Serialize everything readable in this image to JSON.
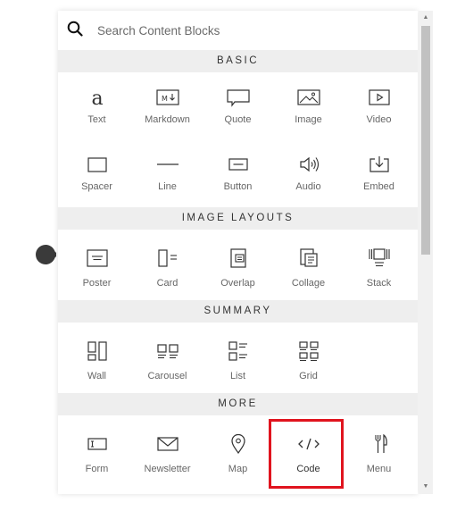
{
  "search": {
    "placeholder": "Search Content Blocks"
  },
  "sections": {
    "basic": {
      "title": "BASIC",
      "items": [
        {
          "label": "Text",
          "icon": "text-icon"
        },
        {
          "label": "Markdown",
          "icon": "markdown-icon"
        },
        {
          "label": "Quote",
          "icon": "quote-icon"
        },
        {
          "label": "Image",
          "icon": "image-icon"
        },
        {
          "label": "Video",
          "icon": "video-icon"
        },
        {
          "label": "Spacer",
          "icon": "spacer-icon"
        },
        {
          "label": "Line",
          "icon": "line-icon"
        },
        {
          "label": "Button",
          "icon": "button-icon"
        },
        {
          "label": "Audio",
          "icon": "audio-icon"
        },
        {
          "label": "Embed",
          "icon": "embed-icon"
        }
      ]
    },
    "image_layouts": {
      "title": "IMAGE LAYOUTS",
      "items": [
        {
          "label": "Poster",
          "icon": "poster-icon"
        },
        {
          "label": "Card",
          "icon": "card-icon"
        },
        {
          "label": "Overlap",
          "icon": "overlap-icon"
        },
        {
          "label": "Collage",
          "icon": "collage-icon"
        },
        {
          "label": "Stack",
          "icon": "stack-icon"
        }
      ]
    },
    "summary": {
      "title": "SUMMARY",
      "items": [
        {
          "label": "Wall",
          "icon": "wall-icon"
        },
        {
          "label": "Carousel",
          "icon": "carousel-icon"
        },
        {
          "label": "List",
          "icon": "list-icon"
        },
        {
          "label": "Grid",
          "icon": "grid-icon"
        }
      ]
    },
    "more": {
      "title": "MORE",
      "items": [
        {
          "label": "Form",
          "icon": "form-icon"
        },
        {
          "label": "Newsletter",
          "icon": "newsletter-icon"
        },
        {
          "label": "Map",
          "icon": "map-icon"
        },
        {
          "label": "Code",
          "icon": "code-icon",
          "highlighted": true
        },
        {
          "label": "Menu",
          "icon": "menu-icon"
        }
      ]
    }
  },
  "colors": {
    "highlight": "#e0141e",
    "section_bg": "#eeeeee",
    "handle": "#3a3a3a"
  }
}
